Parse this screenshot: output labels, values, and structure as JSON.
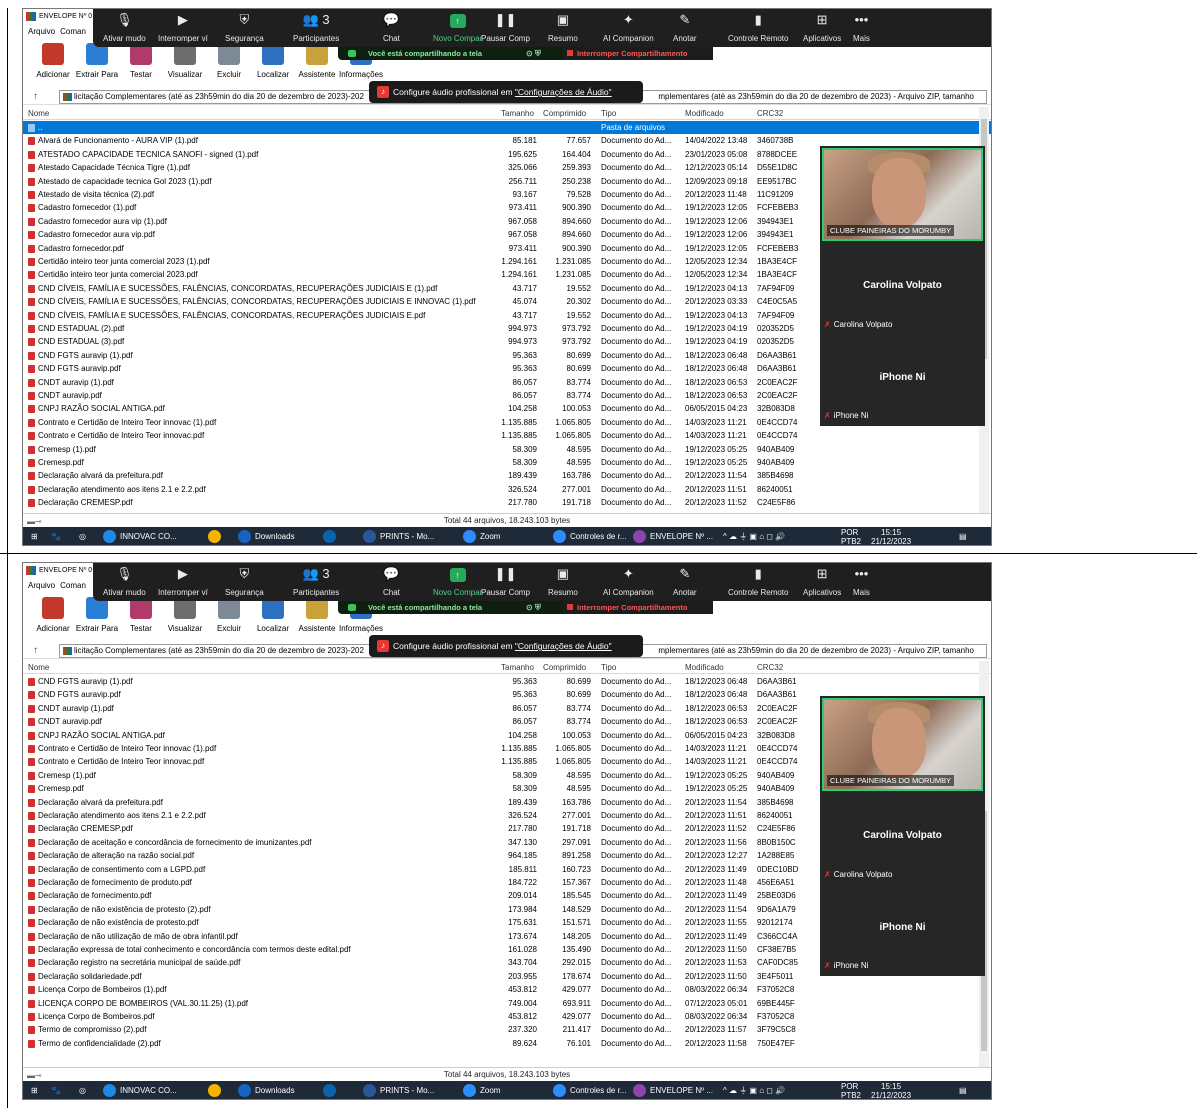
{
  "window": {
    "title": "ENVELOPE Nº 0",
    "close": "✕"
  },
  "menu": [
    "Arquivo",
    "Coman"
  ],
  "ribbon": [
    {
      "label": "Adicionar",
      "icon": "add-archive-icon",
      "color": "#c0392b"
    },
    {
      "label": "Extrair Para",
      "icon": "extract-icon",
      "color": "#2a7fd4"
    },
    {
      "label": "Testar",
      "icon": "test-icon",
      "color": "#b03a6a"
    },
    {
      "label": "Visualizar",
      "icon": "view-icon",
      "color": "#6d6d6d"
    },
    {
      "label": "Excluir",
      "icon": "delete-icon",
      "color": "#7d8a96"
    },
    {
      "label": "Localizar",
      "icon": "find-icon",
      "color": "#2e6fbf"
    },
    {
      "label": "Assistente",
      "icon": "wizard-icon",
      "color": "#c8a13a"
    },
    {
      "label": "Informações",
      "icon": "info-icon",
      "color": "#2e6fbf"
    }
  ],
  "zoom": {
    "buttons": [
      {
        "label": "Ativar mudo",
        "icon": "mic-icon",
        "glyph": "🎙"
      },
      {
        "label": "Interromper ví",
        "icon": "video-icon",
        "glyph": "▶"
      },
      {
        "label": "Segurança",
        "icon": "shield-icon",
        "glyph": "⛨"
      },
      {
        "label": "Participantes",
        "icon": "participants-icon",
        "glyph": "👥 3"
      },
      {
        "label": "Chat",
        "icon": "chat-icon",
        "glyph": "💬"
      },
      {
        "label": "Novo Compar",
        "icon": "share-screen-icon",
        "glyph": "↑"
      },
      {
        "label": "Pausar Comp",
        "icon": "pause-icon",
        "glyph": "❚❚"
      },
      {
        "label": "Resumo",
        "icon": "summary-icon",
        "glyph": "▣"
      },
      {
        "label": "AI Companion",
        "icon": "ai-companion-icon",
        "glyph": "✦"
      },
      {
        "label": "Anotar",
        "icon": "annotate-icon",
        "glyph": "✎"
      },
      {
        "label": "Controle Remoto",
        "icon": "remote-control-icon",
        "glyph": "▮"
      },
      {
        "label": "Aplicativos",
        "icon": "apps-icon",
        "glyph": "⊞"
      },
      {
        "label": "Mais",
        "icon": "more-icon",
        "glyph": "•••"
      }
    ],
    "sharing_text": "Você está compartilhando a tela",
    "stop_share": "Interromper Compartilhamento",
    "audio_tip": "Configure áudio profissional em ",
    "audio_link": "\"Configurações de Áudio\""
  },
  "address": {
    "left": "licitação Complementares (até as 23h59min do dia 20 de dezembro de 2023)-202",
    "right": "mplementares (até as 23h59min do dia 20 de dezembro de 2023) - Arquivo ZIP, tamanho"
  },
  "columns": [
    "Nome",
    "Tamanho",
    "Comprimido",
    "Tipo",
    "Modificado",
    "CRC32"
  ],
  "parent_row": {
    "name": "..",
    "type": "Pasta de arquivos"
  },
  "files": [
    {
      "name": "Alvará de Funcionamento - AURA VIP (1).pdf",
      "size": "85.181",
      "comp": "77.657",
      "type": "Documento do Ad...",
      "mod": "14/04/2022 13:48",
      "crc": "3460738B"
    },
    {
      "name": "ATESTADO CAPACIDADE TECNICA  SANOFI - signed (1).pdf",
      "size": "195.625",
      "comp": "164.404",
      "type": "Documento do Ad...",
      "mod": "23/01/2023 05:08",
      "crc": "8788DCEE"
    },
    {
      "name": "Atestado Capacidade Técnica Tigre (1).pdf",
      "size": "325.066",
      "comp": "259.393",
      "type": "Documento do Ad...",
      "mod": "12/12/2023 05:14",
      "crc": "D55E1D8C"
    },
    {
      "name": "Atestado de capacidade tecnica Gol 2023 (1).pdf",
      "size": "256.711",
      "comp": "250.238",
      "type": "Documento do Ad...",
      "mod": "12/09/2023 09:18",
      "crc": "EE9517BC"
    },
    {
      "name": "Atestado de visita técnica (2).pdf",
      "size": "93.167",
      "comp": "79.528",
      "type": "Documento do Ad...",
      "mod": "20/12/2023 11:48",
      "crc": "11C91209"
    },
    {
      "name": "Cadastro fornecedor (1).pdf",
      "size": "973.411",
      "comp": "900.390",
      "type": "Documento do Ad...",
      "mod": "19/12/2023 12:05",
      "crc": "FCFEBEB3"
    },
    {
      "name": "Cadastro fornecedor aura vip (1).pdf",
      "size": "967.058",
      "comp": "894.660",
      "type": "Documento do Ad...",
      "mod": "19/12/2023 12:06",
      "crc": "394943E1"
    },
    {
      "name": "Cadastro fornecedor aura vip.pdf",
      "size": "967.058",
      "comp": "894.660",
      "type": "Documento do Ad...",
      "mod": "19/12/2023 12:06",
      "crc": "394943E1"
    },
    {
      "name": "Cadastro fornecedor.pdf",
      "size": "973.411",
      "comp": "900.390",
      "type": "Documento do Ad...",
      "mod": "19/12/2023 12:05",
      "crc": "FCFEBEB3"
    },
    {
      "name": "Certidão inteiro teor junta comercial 2023 (1).pdf",
      "size": "1.294.161",
      "comp": "1.231.085",
      "type": "Documento do Ad...",
      "mod": "12/05/2023 12:34",
      "crc": "1BA3E4CF"
    },
    {
      "name": "Certidão inteiro teor junta comercial 2023.pdf",
      "size": "1.294.161",
      "comp": "1.231.085",
      "type": "Documento do Ad...",
      "mod": "12/05/2023 12:34",
      "crc": "1BA3E4CF"
    },
    {
      "name": "CND CÍVEIS, FAMÍLIA E SUCESSÕES, FALÊNCIAS, CONCORDATAS, RECUPERAÇÕES JUDICIAIS E (1).pdf",
      "size": "43.717",
      "comp": "19.552",
      "type": "Documento do Ad...",
      "mod": "19/12/2023 04:13",
      "crc": "7AF94F09"
    },
    {
      "name": "CND CÍVEIS, FAMÍLIA E SUCESSÕES, FALÊNCIAS, CONCORDATAS, RECUPERAÇÕES JUDICIAIS E INNOVAC (1).pdf",
      "size": "45.074",
      "comp": "20.302",
      "type": "Documento do Ad...",
      "mod": "20/12/2023 03:33",
      "crc": "C4E0C5A5"
    },
    {
      "name": "CND CÍVEIS, FAMÍLIA E SUCESSÕES, FALÊNCIAS, CONCORDATAS, RECUPERAÇÕES JUDICIAIS E.pdf",
      "size": "43.717",
      "comp": "19.552",
      "type": "Documento do Ad...",
      "mod": "19/12/2023 04:13",
      "crc": "7AF94F09"
    },
    {
      "name": "CND ESTADUAL (2).pdf",
      "size": "994.973",
      "comp": "973.792",
      "type": "Documento do Ad...",
      "mod": "19/12/2023 04:19",
      "crc": "020352D5"
    },
    {
      "name": "CND ESTADUAL (3).pdf",
      "size": "994.973",
      "comp": "973.792",
      "type": "Documento do Ad...",
      "mod": "19/12/2023 04:19",
      "crc": "020352D5"
    },
    {
      "name": "CND FGTS auravip (1).pdf",
      "size": "95.363",
      "comp": "80.699",
      "type": "Documento do Ad...",
      "mod": "18/12/2023 06:48",
      "crc": "D6AA3B61"
    },
    {
      "name": "CND FGTS auravip.pdf",
      "size": "95.363",
      "comp": "80.699",
      "type": "Documento do Ad...",
      "mod": "18/12/2023 06:48",
      "crc": "D6AA3B61"
    },
    {
      "name": "CNDT auravip (1).pdf",
      "size": "86.057",
      "comp": "83.774",
      "type": "Documento do Ad...",
      "mod": "18/12/2023 06:53",
      "crc": "2C0EAC2F"
    },
    {
      "name": "CNDT auravip.pdf",
      "size": "86.057",
      "comp": "83.774",
      "type": "Documento do Ad...",
      "mod": "18/12/2023 06:53",
      "crc": "2C0EAC2F"
    },
    {
      "name": "CNPJ RAZÃO SOCIAL ANTIGA.pdf",
      "size": "104.258",
      "comp": "100.053",
      "type": "Documento do Ad...",
      "mod": "06/05/2015 04:23",
      "crc": "32B083D8"
    },
    {
      "name": "Contrato e Certidão de Inteiro Teor innovac (1).pdf",
      "size": "1.135.885",
      "comp": "1.065.805",
      "type": "Documento do Ad...",
      "mod": "14/03/2023 11:21",
      "crc": "0E4CCD74"
    },
    {
      "name": "Contrato e Certidão de Inteiro Teor innovac.pdf",
      "size": "1.135.885",
      "comp": "1.065.805",
      "type": "Documento do Ad...",
      "mod": "14/03/2023 11:21",
      "crc": "0E4CCD74"
    },
    {
      "name": "Cremesp (1).pdf",
      "size": "58.309",
      "comp": "48.595",
      "type": "Documento do Ad...",
      "mod": "19/12/2023 05:25",
      "crc": "940AB409"
    },
    {
      "name": "Cremesp.pdf",
      "size": "58.309",
      "comp": "48.595",
      "type": "Documento do Ad...",
      "mod": "19/12/2023 05:25",
      "crc": "940AB409"
    },
    {
      "name": "Declaração alvará da prefeitura.pdf",
      "size": "189.439",
      "comp": "163.786",
      "type": "Documento do Ad...",
      "mod": "20/12/2023 11:54",
      "crc": "385B4698"
    },
    {
      "name": "Declaração atendimento aos itens 2.1 e 2.2.pdf",
      "size": "326.524",
      "comp": "277.001",
      "type": "Documento do Ad...",
      "mod": "20/12/2023 11:51",
      "crc": "86240051"
    },
    {
      "name": "Declaração CREMESP.pdf",
      "size": "217.780",
      "comp": "191.718",
      "type": "Documento do Ad...",
      "mod": "20/12/2023 11:52",
      "crc": "C24E5F86"
    },
    {
      "name": "Declaração de aceitação e concordância de fornecimento de imunizantes.pdf",
      "size": "347.130",
      "comp": "297.091",
      "type": "Documento do Ad...",
      "mod": "20/12/2023 11:56",
      "crc": "8B0B150C"
    },
    {
      "name": "Declaração de alteração na razão social.pdf",
      "size": "964.185",
      "comp": "891.258",
      "type": "Documento do Ad...",
      "mod": "20/12/2023 12:27",
      "crc": "1A288E85"
    },
    {
      "name": "Declaração de consentimento com a LGPD.pdf",
      "size": "185.811",
      "comp": "160.723",
      "type": "Documento do Ad...",
      "mod": "20/12/2023 11:49",
      "crc": "0DEC10BD"
    },
    {
      "name": "Declaração de fornecimento de produto.pdf",
      "size": "184.722",
      "comp": "157.367",
      "type": "Documento do Ad...",
      "mod": "20/12/2023 11:48",
      "crc": "456E6A51"
    },
    {
      "name": "Declaração de fornecimento.pdf",
      "size": "209.014",
      "comp": "185.545",
      "type": "Documento do Ad...",
      "mod": "20/12/2023 11:49",
      "crc": "25BE03D6"
    },
    {
      "name": "Declaração de não existência de protesto (2).pdf",
      "size": "173.984",
      "comp": "148.529",
      "type": "Documento do Ad...",
      "mod": "20/12/2023 11:54",
      "crc": "9D6A1A79"
    },
    {
      "name": "Declaração de não existência de protesto.pdf",
      "size": "175.631",
      "comp": "151.571",
      "type": "Documento do Ad...",
      "mod": "20/12/2023 11:55",
      "crc": "92012174"
    },
    {
      "name": "Declaração de não utilização de mão de obra infantil.pdf",
      "size": "173.674",
      "comp": "148.205",
      "type": "Documento do Ad...",
      "mod": "20/12/2023 11:49",
      "crc": "C366CC4A"
    },
    {
      "name": "Declaração expressa de total conhecimento e concordância com termos deste edital.pdf",
      "size": "161.028",
      "comp": "135.490",
      "type": "Documento do Ad...",
      "mod": "20/12/2023 11:50",
      "crc": "CF38E7B5"
    },
    {
      "name": "Declaração registro na secretária municipal de saúde.pdf",
      "size": "343.704",
      "comp": "292.015",
      "type": "Documento do Ad...",
      "mod": "20/12/2023 11:53",
      "crc": "CAF0DC85"
    },
    {
      "name": "Declaração solidariedade.pdf",
      "size": "203.955",
      "comp": "178.674",
      "type": "Documento do Ad...",
      "mod": "20/12/2023 11:50",
      "crc": "3E4F5011"
    },
    {
      "name": "Licença Corpo de Bombeiros (1).pdf",
      "size": "453.812",
      "comp": "429.077",
      "type": "Documento do Ad...",
      "mod": "08/03/2022 06:34",
      "crc": "F37052C8"
    },
    {
      "name": "LICENÇA CORPO DE BOMBEIROS (VAL.30.11.25) (1).pdf",
      "size": "749.004",
      "comp": "693.911",
      "type": "Documento do Ad...",
      "mod": "07/12/2023 05:01",
      "crc": "69BE445F"
    },
    {
      "name": "Licença Corpo de Bombeiros.pdf",
      "size": "453.812",
      "comp": "429.077",
      "type": "Documento do Ad...",
      "mod": "08/03/2022 06:34",
      "crc": "F37052C8"
    },
    {
      "name": "Termo de compromisso (2).pdf",
      "size": "237.320",
      "comp": "211.417",
      "type": "Documento do Ad...",
      "mod": "20/12/2023 11:57",
      "crc": "3F79C5C8"
    },
    {
      "name": "Termo de confidencialidade (2).pdf",
      "size": "89.624",
      "comp": "76.101",
      "type": "Documento do Ad...",
      "mod": "20/12/2023 11:58",
      "crc": "750E47EF"
    }
  ],
  "status": "Total 44 arquivos, 18.243.103 bytes",
  "panel": {
    "video_caption": "CLUBE PAINEIRAS DO MORUMBY",
    "participant1": "Carolina Volpato",
    "participant2": "iPhone Ni"
  },
  "taskbar": {
    "items": [
      {
        "label": "INNOVAC CO...",
        "icon": "edge-icon",
        "color": "#1e88e5"
      },
      {
        "label": "",
        "icon": "chrome-icon",
        "color": "#f4b400"
      },
      {
        "label": "Downloads",
        "icon": "downloads-icon",
        "color": "#1565c0"
      },
      {
        "label": "",
        "icon": "outlook-icon",
        "color": "#0a64ad"
      },
      {
        "label": "PRINTS - Mo...",
        "icon": "word-icon",
        "color": "#2b579a"
      },
      {
        "label": "Zoom",
        "icon": "zoom-icon",
        "color": "#2d8cff"
      },
      {
        "label": "Controles de r...",
        "icon": "zoom-remote-icon",
        "color": "#2d8cff"
      },
      {
        "label": "ENVELOPE Nº ...",
        "icon": "winrar-icon",
        "color": "#8e44ad"
      }
    ],
    "lang": "POR",
    "layout": "PTB2",
    "time": "15:15",
    "date": "21/12/2023"
  }
}
